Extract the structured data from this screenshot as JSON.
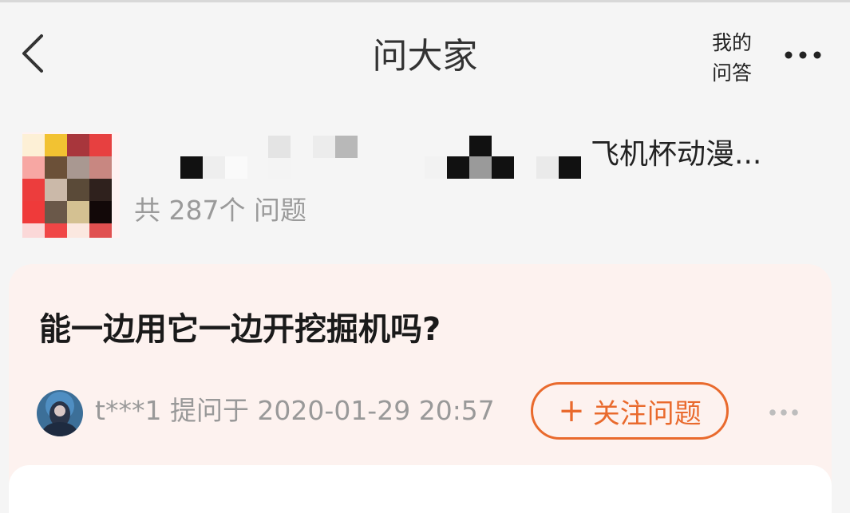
{
  "header": {
    "back_icon": "chevron-left-icon",
    "title": "问大家",
    "my_qa_line1": "我的",
    "my_qa_line2": "问答",
    "more_icon": "more-horizontal-icon"
  },
  "product": {
    "name_visible": "飞机杯动漫...",
    "question_count": "共 287个 问题"
  },
  "question_card": {
    "question": "能一边用它一边开挖掘机吗?",
    "asker_name": "t***1",
    "asked_at": "提问于 2020-01-29 20:57",
    "follow_label": "关注问题",
    "follow_plus": "+",
    "more_icon": "more-horizontal-icon"
  },
  "colors": {
    "accent": "#e96a2d",
    "card_bg": "#fdf2ef",
    "page_bg": "#f5f5f5",
    "muted_text": "#999999"
  }
}
